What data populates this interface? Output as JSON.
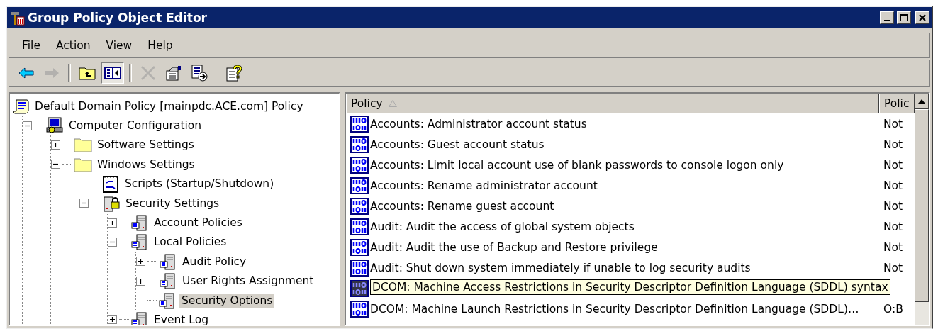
{
  "window": {
    "title": "Group Policy Object Editor"
  },
  "menu": [
    {
      "label": "File"
    },
    {
      "label": "Action"
    },
    {
      "label": "View"
    },
    {
      "label": "Help"
    }
  ],
  "toolbar": [
    {
      "kind": "back",
      "disabled": false,
      "pressed": false
    },
    {
      "kind": "forward",
      "disabled": true,
      "pressed": false
    },
    {
      "kind": "separator"
    },
    {
      "kind": "up",
      "disabled": false,
      "pressed": false
    },
    {
      "kind": "tree",
      "disabled": false,
      "pressed": true
    },
    {
      "kind": "separator"
    },
    {
      "kind": "delete",
      "disabled": true,
      "pressed": false
    },
    {
      "kind": "properties",
      "disabled": false,
      "pressed": false
    },
    {
      "kind": "export",
      "disabled": false,
      "pressed": false
    },
    {
      "kind": "separator"
    },
    {
      "kind": "help",
      "disabled": false,
      "pressed": false
    }
  ],
  "tree": {
    "label": "Default Domain Policy [mainpdc.ACE.com] Policy",
    "kind": "policy",
    "selected": false,
    "children": [
      {
        "label": "Computer Configuration",
        "kind": "computer",
        "selected": false,
        "expanded": true,
        "children": [
          {
            "label": "Software Settings",
            "kind": "folder",
            "selected": false,
            "expanded": false
          },
          {
            "label": "Windows Settings",
            "kind": "folder",
            "selected": false,
            "expanded": true,
            "children": [
              {
                "label": "Scripts (Startup/Shutdown)",
                "kind": "script",
                "selected": false
              },
              {
                "label": "Security Settings",
                "kind": "security",
                "selected": false,
                "expanded": true,
                "children": [
                  {
                    "label": "Account Policies",
                    "kind": "server",
                    "selected": false,
                    "expanded": false
                  },
                  {
                    "label": "Local Policies",
                    "kind": "server",
                    "selected": false,
                    "expanded": true,
                    "children": [
                      {
                        "label": "Audit Policy",
                        "kind": "server",
                        "selected": false,
                        "expanded": false
                      },
                      {
                        "label": "User Rights Assignment",
                        "kind": "server",
                        "selected": false,
                        "expanded": false
                      },
                      {
                        "label": "Security Options",
                        "kind": "server",
                        "selected": true
                      }
                    ]
                  },
                  {
                    "label": "Event Log",
                    "kind": "server",
                    "selected": false,
                    "expanded": false
                  }
                ]
              }
            ]
          }
        ]
      }
    ]
  },
  "table": {
    "columns": [
      {
        "label": "Policy",
        "sorted": true
      },
      {
        "label": "Polic"
      }
    ],
    "rows": [
      {
        "policy": "Accounts: Administrator account status",
        "setting": "Not",
        "selected": false
      },
      {
        "policy": "Accounts: Guest account status",
        "setting": "Not",
        "selected": false
      },
      {
        "policy": "Accounts: Limit local account use of blank passwords to console logon only",
        "setting": "Not",
        "selected": false
      },
      {
        "policy": "Accounts: Rename administrator account",
        "setting": "Not",
        "selected": false
      },
      {
        "policy": "Accounts: Rename guest account",
        "setting": "Not",
        "selected": false
      },
      {
        "policy": "Audit: Audit the access of global system objects",
        "setting": "Not",
        "selected": false
      },
      {
        "policy": "Audit: Audit the use of Backup and Restore privilege",
        "setting": "Not",
        "selected": false
      },
      {
        "policy": "Audit: Shut down system immediately if unable to log security audits",
        "setting": "Not",
        "selected": false
      },
      {
        "tooltip": "DCOM: Machine Access Restrictions in Security Descriptor Definition Language (SDDL) syntax",
        "selected": true
      },
      {
        "policy": "DCOM: Machine Launch Restrictions in Security Descriptor Definition Language (SDDL)…",
        "setting": "O:B",
        "selected": false
      }
    ]
  }
}
